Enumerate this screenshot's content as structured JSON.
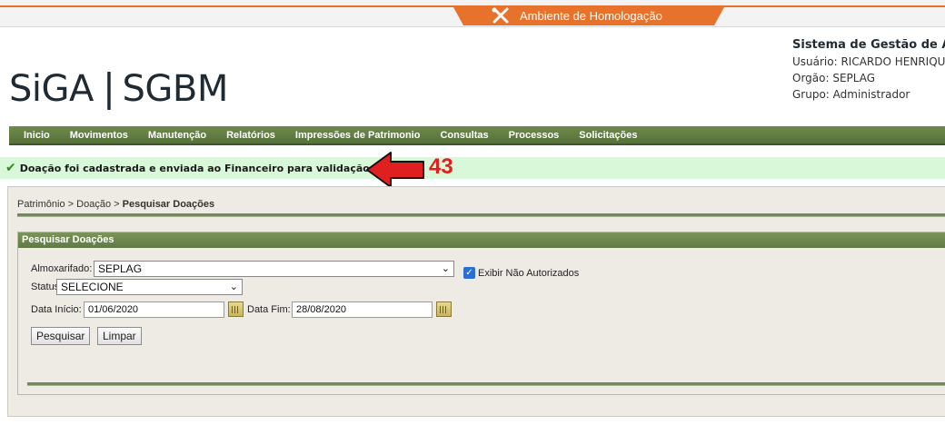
{
  "env": {
    "label": "Ambiente de Homologação",
    "icon": "tools-icon"
  },
  "header": {
    "logo_left": "SiGA",
    "logo_sep": "|",
    "logo_right": "SGBM",
    "system_title": "Sistema de Gestão de Almo",
    "user": "Usuário: RICARDO HENRIQUE",
    "org": "Orgão: SEPLAG",
    "group": "Grupo: Administrador"
  },
  "menu": [
    "Inicio",
    "Movimentos",
    "Manutenção",
    "Relatórios",
    "Impressões de Patrimonio",
    "Consultas",
    "Processos",
    "Solicitações"
  ],
  "message": {
    "text": "Doação foi cadastrada e enviada ao Financeiro para validação.",
    "annotation": "43"
  },
  "breadcrumb": {
    "part1": "Patrimônio",
    "sep1": ">",
    "part2": "Doação",
    "sep2": ">",
    "current": "Pesquisar Doações"
  },
  "search": {
    "title": "Pesquisar Doações",
    "almox_label": "Almoxarifado:",
    "almox_value": "SEPLAG",
    "status_label": "Status",
    "status_value": "SELECIONE",
    "exibir_label": "Exibir Não Autorizados",
    "data_inicio_label": "Data Início:",
    "data_inicio_value": "01/06/2020",
    "data_fim_label": "Data Fim:",
    "data_fim_value": "28/08/2020",
    "btn_search": "Pesquisar",
    "btn_clear": "Limpar"
  },
  "colors": {
    "menu_green": "#5f7a43",
    "env_orange": "#e6722c",
    "success_bg": "#d9f7d9",
    "arrow_red": "#e02020"
  }
}
